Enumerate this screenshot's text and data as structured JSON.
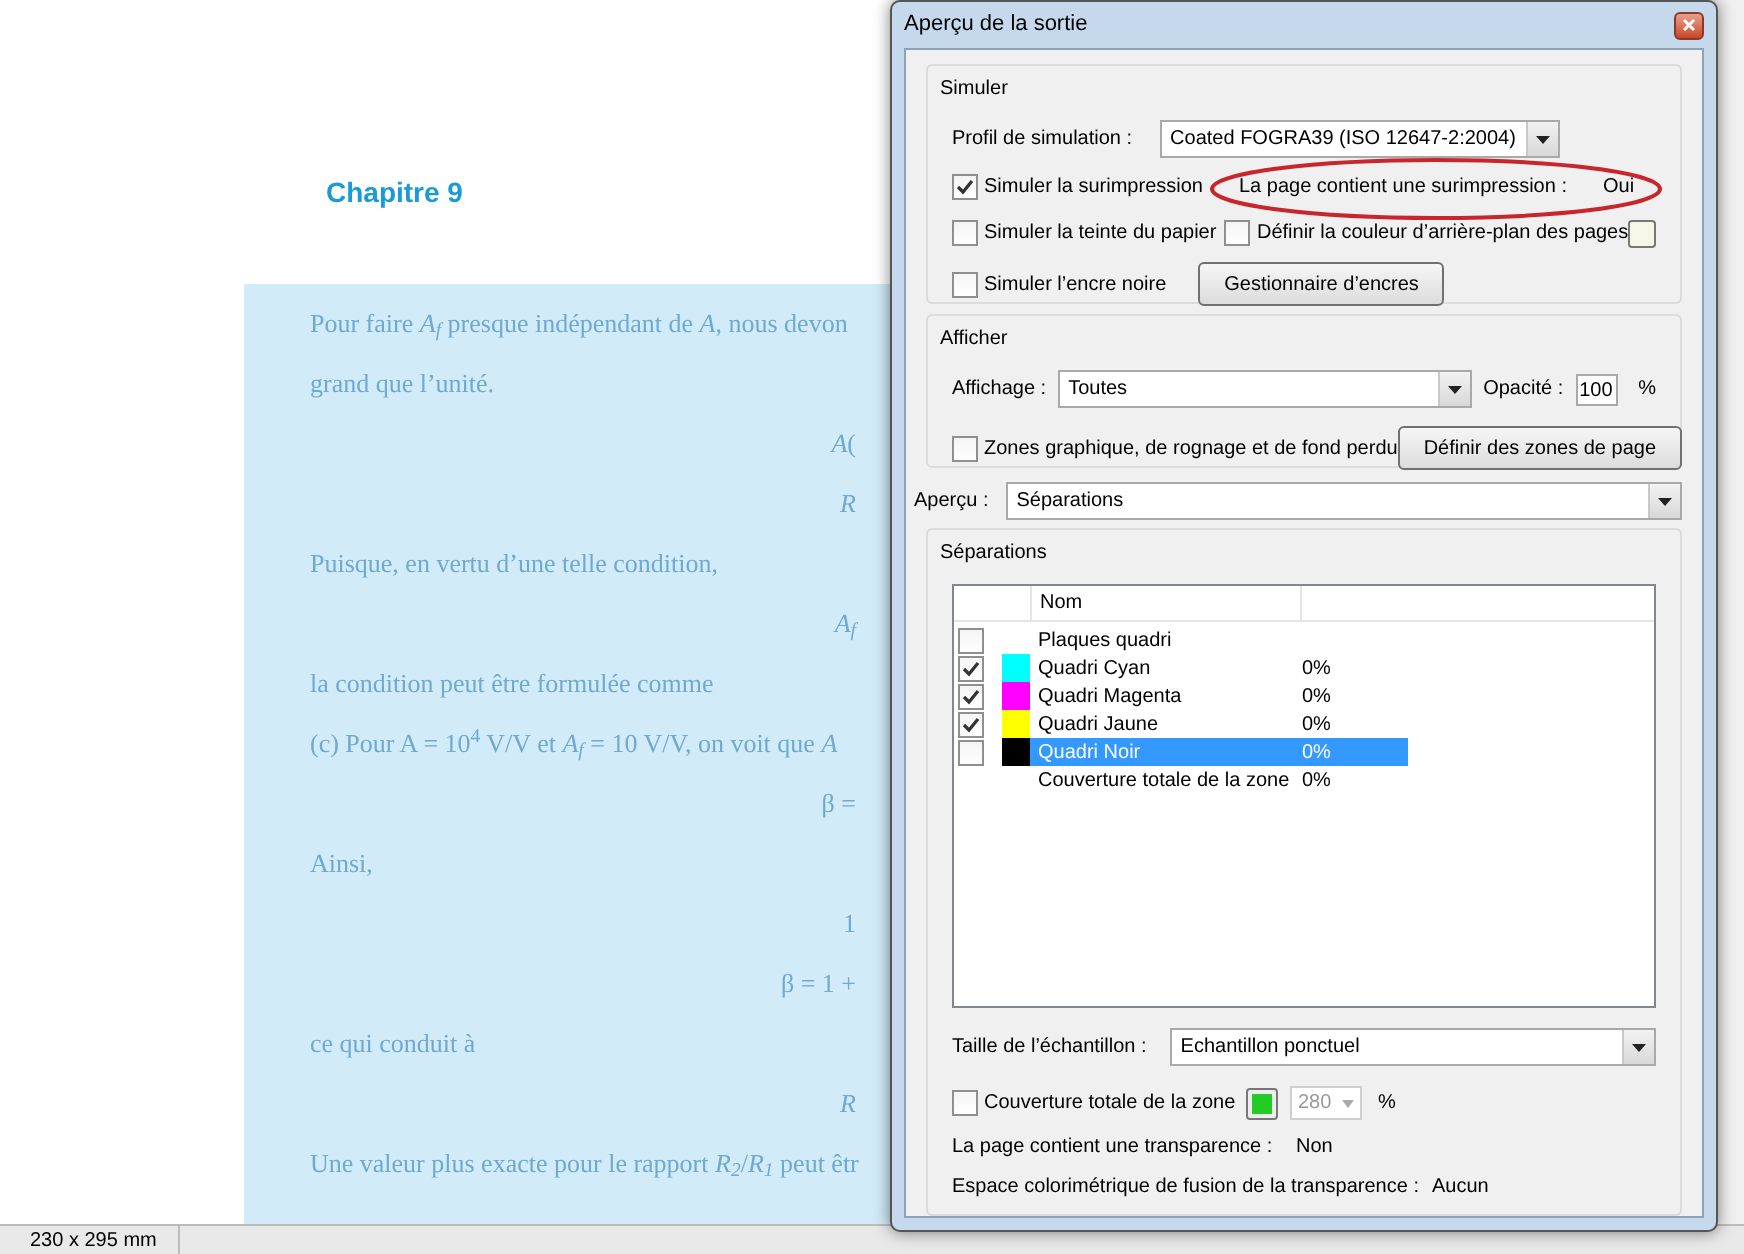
{
  "document": {
    "heading": "Chapitre 9",
    "lines": [
      {
        "kind": "text",
        "text": "Pour faire *A$_{f}$* presque indépendant de *A*, nous devon"
      },
      {
        "kind": "text",
        "text": "grand que l’unité."
      },
      {
        "kind": "formula",
        "text": "*A*("
      },
      {
        "kind": "formula",
        "text": "*R*"
      },
      {
        "kind": "text",
        "text": "Puisque, en vertu d’une telle condition,"
      },
      {
        "kind": "formula",
        "text": "*A$_{f}$*"
      },
      {
        "kind": "text",
        "text": "la condition peut être formulée comme"
      },
      {
        "kind": "text",
        "text": "(c) Pour A = 10$^{4}$ V/V et *A$_{f}$* = 10 V/V, on voit que *A*"
      },
      {
        "kind": "formula",
        "text": "β ="
      },
      {
        "kind": "text",
        "text": "Ainsi,"
      },
      {
        "kind": "formula",
        "text": "1"
      },
      {
        "kind": "formula",
        "text": "β = 1 +"
      },
      {
        "kind": "text",
        "text": "ce qui conduit à"
      },
      {
        "kind": "formula",
        "text": "*R*"
      },
      {
        "kind": "text",
        "text": "Une valeur plus exacte pour le rapport *R$_{2}$*/*R$_{1}$* peut êtr"
      }
    ]
  },
  "status_bar": {
    "page_size": "230 x 295 mm"
  },
  "dialog": {
    "title": "Aperçu de la sortie",
    "simulate": {
      "title": "Simuler",
      "profile_label": "Profil de simulation :",
      "profile_value": "Coated FOGRA39 (ISO 12647-2:2004)",
      "overprint": {
        "label": "Simuler la surimpression",
        "checked": true
      },
      "overprint_info": {
        "label": "La page contient une surimpression :",
        "value": "Oui"
      },
      "paper": {
        "label": "Simuler la teinte du papier",
        "checked": false
      },
      "background": {
        "label": "Définir la couleur d’arrière-plan des pages",
        "checked": false
      },
      "black_ink": {
        "label": "Simuler l’encre noire",
        "checked": false
      },
      "ink_manager_button": "Gestionnaire d’encres"
    },
    "display": {
      "title": "Afficher",
      "show_label": "Affichage :",
      "show_value": "Toutes",
      "opacity_label": "Opacité :",
      "opacity_value": "100",
      "opacity_unit": "%",
      "zones": {
        "label": "Zones graphique, de rognage et de fond perdu",
        "checked": false
      },
      "zones_button": "Définir des zones de page"
    },
    "preview": {
      "label": "Aperçu :",
      "value": "Séparations"
    },
    "separations": {
      "title": "Séparations",
      "column": "Nom",
      "rows": [
        {
          "kind": "group",
          "name": "Plaques quadri",
          "checked": false,
          "selected": false
        },
        {
          "kind": "ink",
          "name": "Quadri Cyan",
          "coverage": "0%",
          "checked": true,
          "selected": false,
          "color": "#00ffff"
        },
        {
          "kind": "ink",
          "name": "Quadri Magenta",
          "coverage": "0%",
          "checked": true,
          "selected": false,
          "color": "#ff00ff"
        },
        {
          "kind": "ink",
          "name": "Quadri Jaune",
          "coverage": "0%",
          "checked": true,
          "selected": false,
          "color": "#ffff00"
        },
        {
          "kind": "ink",
          "name": "Quadri Noir",
          "coverage": "0%",
          "checked": false,
          "selected": true,
          "color": "#000000"
        },
        {
          "kind": "total",
          "name": "Couverture totale de la zone",
          "coverage": "0%",
          "selected": false
        }
      ]
    },
    "sample": {
      "label": "Taille de l’échantillon :",
      "value": "Echantillon ponctuel"
    },
    "coverage": {
      "label": "Couverture totale de la zone",
      "checked": false,
      "color": "#22cc22",
      "value": "280",
      "disabled": true,
      "unit": "%"
    },
    "transparency": {
      "label": "La page contient une transparence :",
      "value": "Non"
    },
    "blend": {
      "label": "Espace colorimétrique de fusion de la transparence :",
      "value": "Aucun"
    }
  }
}
